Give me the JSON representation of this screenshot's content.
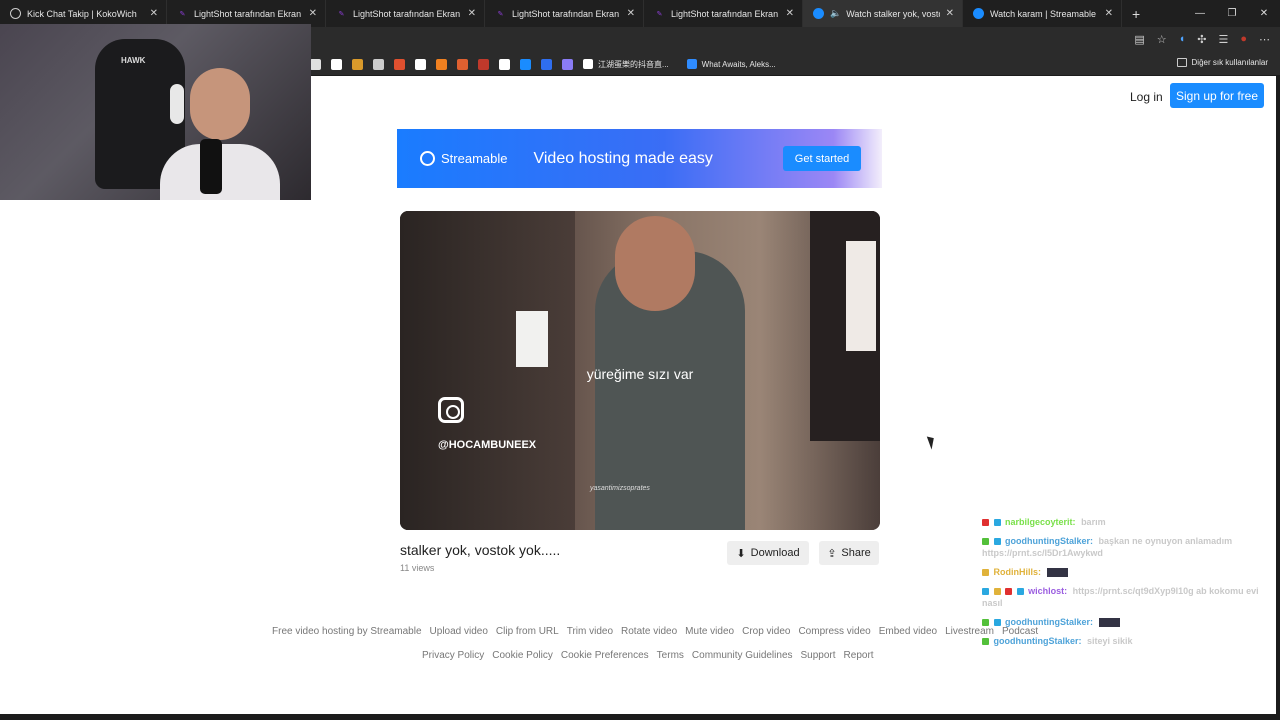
{
  "tabs": [
    {
      "title": "Kick Chat Takip | KokoWich",
      "fav_color": "#555555"
    },
    {
      "title": "LightShot tarafından Ekran Görünt",
      "fav_color": "#8c3dd6"
    },
    {
      "title": "LightShot tarafından Ekran Görünt",
      "fav_color": "#8c3dd6"
    },
    {
      "title": "LightShot tarafından Ekran Görünt",
      "fav_color": "#8c3dd6"
    },
    {
      "title": "LightShot tarafından Ekran Görünt",
      "fav_color": "#8c3dd6"
    },
    {
      "title": "Watch stalker yok, vostok yok",
      "fav_color": "#1a8cff"
    },
    {
      "title": "Watch karam | Streamable",
      "fav_color": "#1a8cff"
    }
  ],
  "bookmarks": {
    "icon_colors": [
      "#e0e0e0",
      "#ffffff",
      "#d99a2b",
      "#cccccc",
      "#e0502f",
      "#ffffff",
      "#f08020",
      "#e06030",
      "#c0392b",
      "#1a8cff",
      "#2f6ef0",
      "#8a7cf5"
    ],
    "named": [
      {
        "label": "江湖蛋樂的抖音直...",
        "color": "#ffffff"
      },
      {
        "label": "What Awaits, Aleks...",
        "color": "#2f8cff"
      }
    ],
    "other": "Diğer sık kullanılanlar"
  },
  "header": {
    "login": "Log in",
    "signup": "Sign up for free"
  },
  "banner": {
    "brand": "Streamable",
    "tagline": "Video hosting made easy",
    "cta": "Get started"
  },
  "video": {
    "caption": "yüreğime sızı var",
    "handle": "@HOCAMBUNEEX",
    "watermark": "yasantimizsoprates",
    "title": "stalker yok, vostok yok.....",
    "views": "11 views",
    "download": "Download",
    "share": "Share"
  },
  "footer": {
    "row1": [
      "Free video hosting by Streamable",
      "Upload video",
      "Clip from URL",
      "Trim video",
      "Rotate video",
      "Mute video",
      "Crop video",
      "Compress video",
      "Embed video",
      "Livestream",
      "Podcast"
    ],
    "row2": [
      "Privacy Policy",
      "Cookie Policy",
      "Cookie Preferences",
      "Terms",
      "Community Guidelines",
      "Support",
      "Report"
    ]
  },
  "webcam": {
    "chair_label": "HAWK"
  },
  "chat": [
    {
      "user": "narbilgecoyterit:",
      "user_color": "#79e04a",
      "msg": "barım",
      "emote": false
    },
    {
      "user": "goodhuntingStalker:",
      "user_color": "#4ea3d9",
      "msg": "başkan ne oynuyon anlamadım https://prnt.sc/l5Dr1Awykwd",
      "emote": false
    },
    {
      "user": "RodinHills:",
      "user_color": "#e0b23a",
      "msg": "",
      "emote": true
    },
    {
      "user": "wichlost:",
      "user_color": "#9b5ee0",
      "msg": "https://prnt.sc/qt9dXyp9l10g ab kokomu evi nasıl",
      "emote": false
    },
    {
      "user": "goodhuntingStalker:",
      "user_color": "#4ea3d9",
      "msg": "",
      "emote": true
    },
    {
      "user": "goodhuntingStalker:",
      "user_color": "#4ea3d9",
      "msg": "siteyi sikik",
      "emote": false
    }
  ]
}
